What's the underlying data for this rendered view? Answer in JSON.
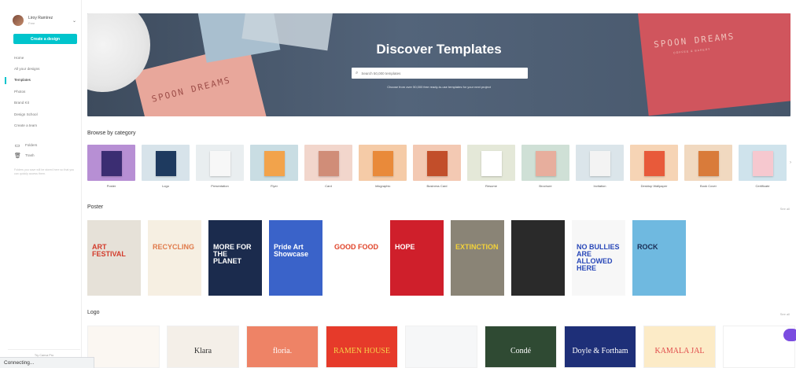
{
  "sidebar": {
    "profile_name": "Liroy Ramírez",
    "profile_sub": "Free",
    "create_label": "Create a design",
    "nav": [
      {
        "label": "Home",
        "active": false
      },
      {
        "label": "All your designs",
        "active": false
      },
      {
        "label": "Templates",
        "active": true
      },
      {
        "label": "Photos",
        "active": false
      },
      {
        "label": "Brand Kit",
        "active": false
      },
      {
        "label": "Design School",
        "active": false
      },
      {
        "label": "Create a team",
        "active": false
      }
    ],
    "folders_label": "Folders",
    "trash_label": "Trash",
    "note": "Folders you save will be stored here so that you can quickly access them.",
    "promo": "Try Canva Pro"
  },
  "status_text": "Connecting...",
  "hero": {
    "title": "Discover Templates",
    "search_placeholder": "Search 50,000 templates",
    "subtitle": "Choose from over 50,000 free ready-to-use templates for your next project",
    "brand_left": "SPOON DREAMS",
    "brand_right": "SPOON DREAMS",
    "brand_right_sub": "COFFEE & BAKERY"
  },
  "categories_section": {
    "title": "Browse by category",
    "items": [
      {
        "label": "Poster",
        "bg": "#b78fd4",
        "inner": "#3b2d72"
      },
      {
        "label": "Logo",
        "bg": "#d7e3ea",
        "inner": "#1e3a5f"
      },
      {
        "label": "Presentation",
        "bg": "#e9eef0",
        "inner": "#f7f7f7"
      },
      {
        "label": "Flyer",
        "bg": "#c9dde3",
        "inner": "#f2a34b"
      },
      {
        "label": "Card",
        "bg": "#f2d6cc",
        "inner": "#d08d78"
      },
      {
        "label": "Infographic",
        "bg": "#f5cba7",
        "inner": "#e98a3a"
      },
      {
        "label": "Business Card",
        "bg": "#f3c9b3",
        "inner": "#c24e2a"
      },
      {
        "label": "Resume",
        "bg": "#e4e8d8",
        "inner": "#ffffff"
      },
      {
        "label": "Brochure",
        "bg": "#cfe0d6",
        "inner": "#e7ae9d"
      },
      {
        "label": "Invitation",
        "bg": "#dbe5ea",
        "inner": "#f3f3f3"
      },
      {
        "label": "Desktop Wallpaper",
        "bg": "#f6d4b5",
        "inner": "#e85a3a"
      },
      {
        "label": "Book Cover",
        "bg": "#f1d9c0",
        "inner": "#d97b3a"
      },
      {
        "label": "Certificate",
        "bg": "#cfe3ec",
        "inner": "#f6c8cf"
      }
    ]
  },
  "poster_section": {
    "title": "Poster",
    "see_all": "See all",
    "items": [
      {
        "bg": "#e6e1d8",
        "fg": "#d33b2b",
        "text": "ART FESTIVAL"
      },
      {
        "bg": "#f6efe2",
        "fg": "#e07a4a",
        "text": "RECYCLING"
      },
      {
        "bg": "#1b2b4d",
        "fg": "#ffffff",
        "text": "MORE FOR THE PLANET"
      },
      {
        "bg": "#3a63c9",
        "fg": "#ffffff",
        "text": "Pride Art Showcase"
      },
      {
        "bg": "#ffffff",
        "fg": "#e0442a",
        "text": "GOOD FOOD"
      },
      {
        "bg": "#cf1f2b",
        "fg": "#ffffff",
        "text": "HOPE"
      },
      {
        "bg": "#8a8476",
        "fg": "#f3d23a",
        "text": "EXTINCTION"
      },
      {
        "bg": "#2a2a2a",
        "fg": "#f1d54a",
        "text": ""
      },
      {
        "bg": "#f7f7f7",
        "fg": "#2847b8",
        "text": "NO BULLIES ARE ALLOWED HERE"
      },
      {
        "bg": "#6fb9e0",
        "fg": "#1a2d54",
        "text": "ROCK"
      }
    ]
  },
  "logo_section": {
    "title": "Logo",
    "see_all": "See all",
    "items": [
      {
        "bg": "#fbf7f2",
        "fg": "#d63b3b",
        "text": ""
      },
      {
        "bg": "#f4efe8",
        "fg": "#333333",
        "text": "Klara"
      },
      {
        "bg": "#ee8366",
        "fg": "#ffffff",
        "text": "floria."
      },
      {
        "bg": "#e63a2a",
        "fg": "#f6d24a",
        "text": "RAMEN HOUSE"
      },
      {
        "bg": "#f6f7f8",
        "fg": "#666666",
        "text": ""
      },
      {
        "bg": "#2f4a33",
        "fg": "#ffffff",
        "text": "Condé"
      },
      {
        "bg": "#1e2f78",
        "fg": "#ffffff",
        "text": "Doyle & Fortham"
      },
      {
        "bg": "#fcebc7",
        "fg": "#e04a4a",
        "text": "KAMALA JAL"
      },
      {
        "bg": "#ffffff",
        "fg": "#d6a43a",
        "text": ""
      }
    ]
  }
}
